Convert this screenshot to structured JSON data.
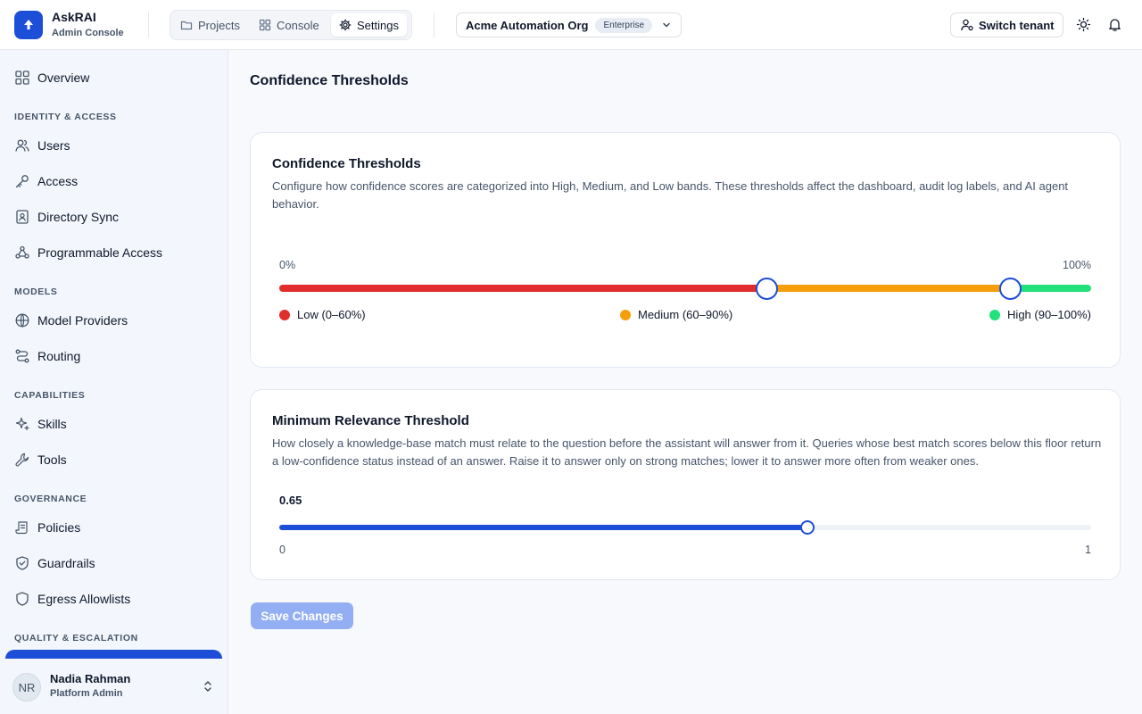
{
  "header": {
    "app_name": "AskRAI",
    "app_subtitle": "Admin Console",
    "tabs": [
      {
        "label": "Projects",
        "icon": "folder-icon",
        "active": false
      },
      {
        "label": "Console",
        "icon": "grid-icon",
        "active": false
      },
      {
        "label": "Settings",
        "icon": "gear-icon",
        "active": true
      }
    ],
    "org": {
      "name": "Acme Automation Org",
      "badge": "Enterprise"
    },
    "switch_tenant": "Switch tenant"
  },
  "sidebar": {
    "overview": "Overview",
    "sections": [
      {
        "heading": "IDENTITY & ACCESS",
        "items": [
          "Users",
          "Access",
          "Directory Sync",
          "Programmable Access"
        ]
      },
      {
        "heading": "MODELS",
        "items": [
          "Model Providers",
          "Routing"
        ]
      },
      {
        "heading": "CAPABILITIES",
        "items": [
          "Skills",
          "Tools"
        ]
      },
      {
        "heading": "GOVERNANCE",
        "items": [
          "Policies",
          "Guardrails",
          "Egress Allowlists"
        ]
      },
      {
        "heading": "QUALITY & ESCALATION",
        "items": []
      }
    ],
    "user": {
      "initials": "NR",
      "name": "Nadia Rahman",
      "role": "Platform Admin"
    }
  },
  "main": {
    "page_title": "Confidence Thresholds",
    "confidence": {
      "title": "Confidence Thresholds",
      "description": "Configure how confidence scores are categorized into High, Medium, and Low bands. These thresholds affect the dashboard, audit log labels, and AI agent behavior.",
      "min_label": "0%",
      "max_label": "100%",
      "low_threshold": 60,
      "high_threshold": 90,
      "bands": [
        {
          "label": "Low (0–60%)",
          "color": "#e22d2d"
        },
        {
          "label": "Medium (60–90%)",
          "color": "#f59e0b"
        },
        {
          "label": "High (90–100%)",
          "color": "#22e07a"
        }
      ]
    },
    "relevance": {
      "title": "Minimum Relevance Threshold",
      "description": "How closely a knowledge-base match must relate to the question before the assistant will answer from it. Queries whose best match scores below this floor return a low-confidence status instead of an answer. Raise it to answer only on strong matches; lower it to answer more often from weaker ones.",
      "value": 0.65,
      "value_label": "0.65",
      "min_label": "0",
      "max_label": "1"
    },
    "save_label": "Save Changes"
  },
  "colors": {
    "accent": "#1d4ed8",
    "save_disabled": "#93aef3"
  }
}
